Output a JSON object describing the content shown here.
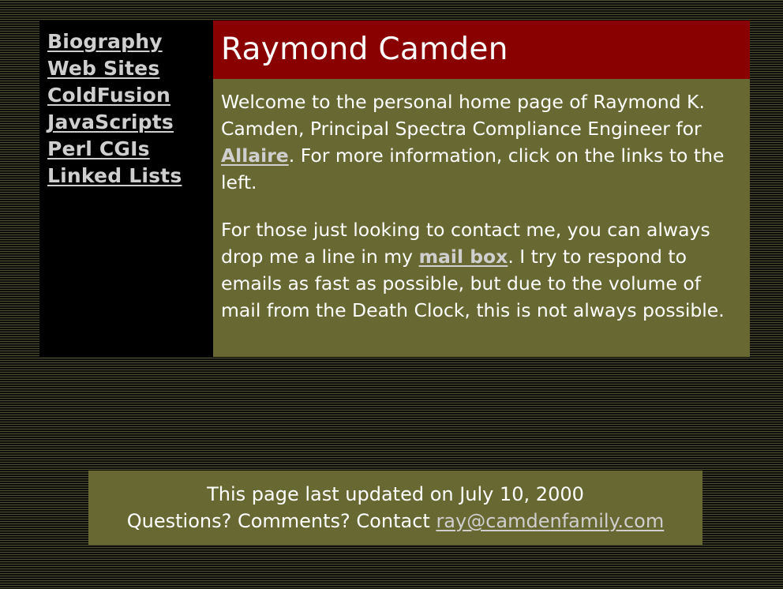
{
  "colors": {
    "title_bar_bg": "#8a0101",
    "content_bg": "#686833",
    "nav_bg": "#000000",
    "link_color": "#cfcfcf",
    "text_color": "#ffffff"
  },
  "nav": {
    "items": [
      {
        "label": "Biography"
      },
      {
        "label": "Web Sites"
      },
      {
        "label": "ColdFusion"
      },
      {
        "label": "JavaScripts"
      },
      {
        "label": "Perl CGIs"
      },
      {
        "label": "Linked Lists"
      }
    ]
  },
  "header": {
    "title": "Raymond Camden"
  },
  "content": {
    "para1": {
      "before": "Welcome to the personal home page of Raymond K. Camden, Principal Spectra Compliance Engineer for ",
      "link": "Allaire",
      "after": ". For more information, click on the links to the left."
    },
    "para2": {
      "before": "For those just looking to contact me, you can always drop me a line in my ",
      "link": "mail box",
      "after": ". I try to respond to emails as fast as possible, but due to the volume of mail from the Death Clock, this is not always possible."
    }
  },
  "footer": {
    "updated": "This page last updated on July 10, 2000",
    "contact_prefix": "Questions? Comments? Contact ",
    "contact_email": "ray@camdenfamily.com"
  }
}
